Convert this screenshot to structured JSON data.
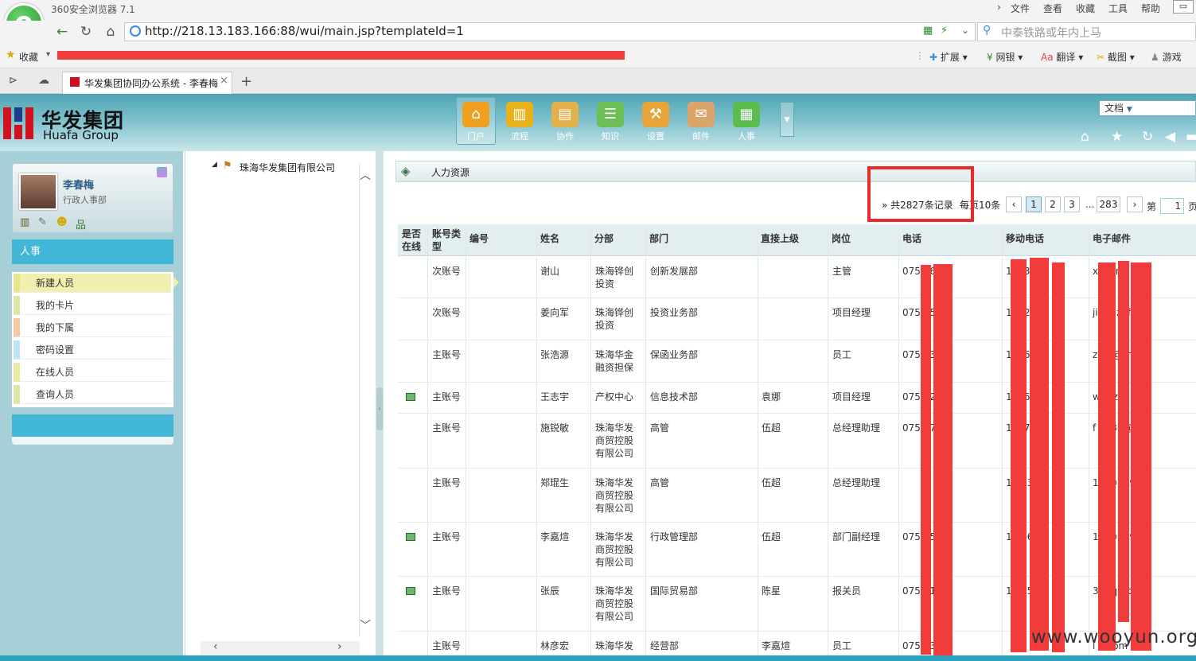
{
  "browser": {
    "title": "360安全浏览器 7.1",
    "menu": [
      "文件",
      "查看",
      "收藏",
      "工具",
      "帮助"
    ],
    "url": "http://218.13.183.166:88/wui/main.jsp?templateId=1",
    "search_placeholder": "中泰铁路或年内上马",
    "favorites_label": "收藏",
    "extensions": [
      "扩展",
      "网银",
      "翻译",
      "截图",
      "游戏"
    ],
    "tab_title": "华发集团协同办公系统 - 李春梅",
    "logo_glyph": "e"
  },
  "app": {
    "logo_cn": "华发集团",
    "logo_en": "Huafa Group",
    "nav": [
      {
        "label": "门户",
        "color": "#f0a020",
        "glyph": "⌂"
      },
      {
        "label": "流程",
        "color": "#e8b21f",
        "glyph": "▥"
      },
      {
        "label": "协作",
        "color": "#e4b04a",
        "glyph": "▤"
      },
      {
        "label": "知识",
        "color": "#6bbf55",
        "glyph": "☰"
      },
      {
        "label": "设置",
        "color": "#e6a53a",
        "glyph": "⚒"
      },
      {
        "label": "邮件",
        "color": "#d9a56a",
        "glyph": "✉"
      },
      {
        "label": "人事",
        "color": "#5bbd4e",
        "glyph": "▦"
      }
    ],
    "doc_select": "文档",
    "tool_icons": [
      "home-icon",
      "star-icon",
      "refresh-icon",
      "back-icon"
    ]
  },
  "user": {
    "name": "李春梅",
    "dept": "行政人事部"
  },
  "left_menu": {
    "section": "人事",
    "items": [
      "新建人员",
      "我的卡片",
      "我的下属",
      "密码设置",
      "在线人员",
      "查询人员"
    ],
    "colors": [
      "#e9e48a",
      "#d8e8a0",
      "#f6c9a0",
      "#bfe3ef",
      "#e7ec9e",
      "#d8e8a0"
    ]
  },
  "tree": {
    "root": "珠海华发集团有限公司"
  },
  "main": {
    "title": "人力资源",
    "pager": {
      "info": "» 共2827条记录",
      "per_page": "每页10条",
      "pages": [
        "1",
        "2",
        "3",
        "283"
      ],
      "ellipsis": "...",
      "goto_label": "第",
      "goto_value": "1",
      "goto_suffix": "页"
    },
    "columns": [
      "是否在线",
      "账号类型",
      "编号",
      "姓名",
      "分部",
      "部门",
      "直接上级",
      "岗位",
      "电话",
      "移动电话",
      "电子邮件"
    ],
    "rows": [
      {
        "online": false,
        "type": "次账号",
        "name": "谢山",
        "branch": [
          "珠海铧创",
          "投资"
        ],
        "dept": "创新发展部",
        "boss": "",
        "post": "主管",
        "phone": "075 365",
        "mobile": "1 3 3 0",
        "email": "x fi.cn"
      },
      {
        "online": false,
        "type": "次账号",
        "name": "姜向军",
        "branch": [
          "珠海铧创",
          "投资"
        ],
        "dept": "投资业务部",
        "boss": "",
        "post": "项目经理",
        "phone": "075 85",
        "mobile": "1 1 285",
        "email": "ji n@zhfi.cn"
      },
      {
        "online": false,
        "type": "主账号",
        "name": "张浩源",
        "branch": [
          "珠海华金",
          "融资担保"
        ],
        "dept": "保函业务部",
        "boss": "",
        "post": "员工",
        "phone": "075 63",
        "mobile": "1 7 685",
        "email": "z an@zhfi.c"
      },
      {
        "online": true,
        "type": "主账号",
        "name": "王志宇",
        "branch": [
          "产权中心"
        ],
        "dept": "信息技术部",
        "boss": "袁娜",
        "post": "项目经理",
        "phone": "075 725",
        "mobile": "1 9 6 3",
        "email": "w @zhfi.cn"
      },
      {
        "online": false,
        "type": "主账号",
        "name": "施锐敏",
        "branch": [
          "珠海华发",
          "商贸控股",
          "有限公司"
        ],
        "dept": "高管",
        "boss": "伍超",
        "post": "总经理助理",
        "phone": "075 97",
        "mobile": "1 0 753",
        "email": "f 1980@12"
      },
      {
        "online": false,
        "type": "主账号",
        "name": "郑琨生",
        "branch": [
          "珠海华发",
          "商贸控股",
          "有限公司"
        ],
        "dept": "高管",
        "boss": "伍超",
        "post": "总经理助理",
        "phone": "",
        "mobile": "1 433",
        "email": "1 3@189.co"
      },
      {
        "online": true,
        "type": "主账号",
        "name": "李嘉煊",
        "branch": [
          "珠海华发",
          "商贸控股",
          "有限公司"
        ],
        "dept": "行政管理部",
        "boss": "伍超",
        "post": "部门副经理",
        "phone": "075 55",
        "mobile": "1 2865",
        "email": "1 5@139.co"
      },
      {
        "online": true,
        "type": "主账号",
        "name": "张辰",
        "branch": [
          "珠海华发",
          "商贸控股",
          "有限公司"
        ],
        "dept": "国际贸易部",
        "boss": "陈星",
        "post": "报关员",
        "phone": "075 11",
        "mobile": "1 075",
        "email": "3 @qq.com"
      },
      {
        "online": false,
        "type": "主账号",
        "name": "林彦宏",
        "branch": [
          "珠海华发"
        ],
        "dept": "经营部",
        "boss": "李嘉煊",
        "post": "员工",
        "phone": "075 63",
        "mobile": "",
        "email": "l 6.com"
      }
    ]
  },
  "watermark": "www.wooyun.org"
}
